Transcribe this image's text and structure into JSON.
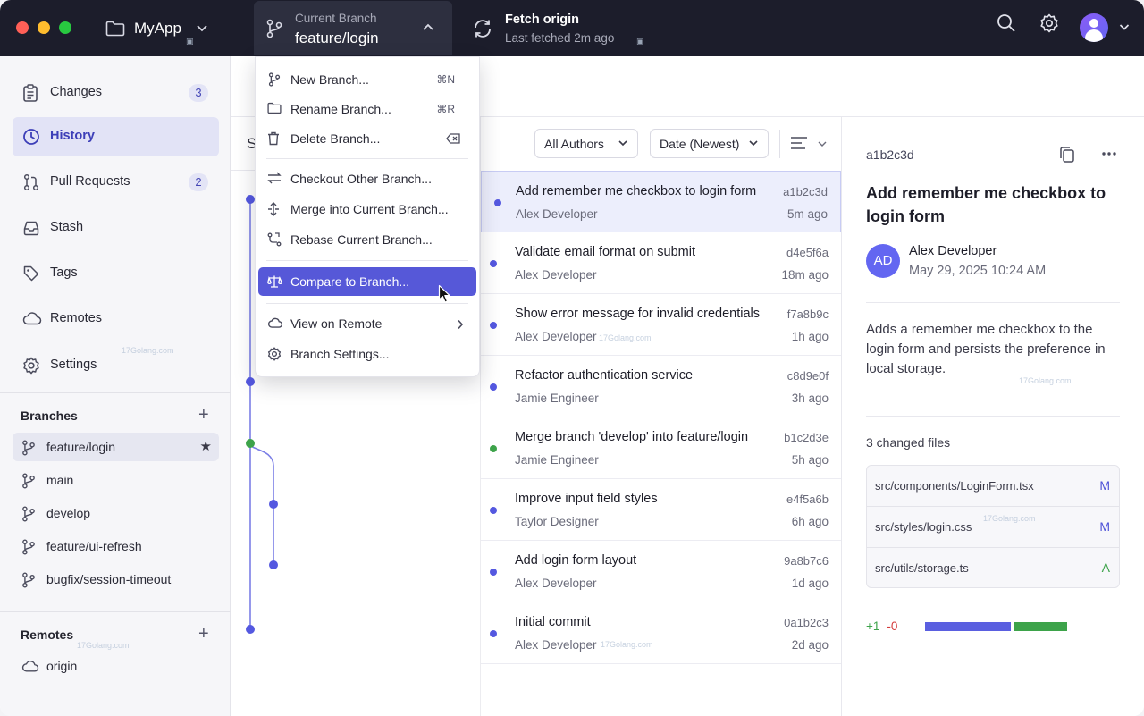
{
  "titlebar": {
    "app_name": "MyApp",
    "branch_label": "Current Branch",
    "branch_value": "feature/login",
    "fetch_title": "Fetch origin",
    "fetch_sub": "Last fetched 2m ago"
  },
  "sidebar": {
    "items": [
      {
        "label": "Changes",
        "badge": "3"
      },
      {
        "label": "History",
        "badge": ""
      },
      {
        "label": "Pull Requests",
        "badge": "2"
      },
      {
        "label": "Stash",
        "badge": ""
      },
      {
        "label": "Tags",
        "badge": ""
      },
      {
        "label": "Remotes",
        "badge": ""
      },
      {
        "label": "Settings",
        "badge": ""
      }
    ],
    "branches_title": "Branches",
    "branches": [
      "feature/login",
      "main",
      "develop",
      "feature/ui-refresh",
      "bugfix/session-timeout"
    ],
    "remotes_title": "Remotes",
    "remotes": [
      "origin"
    ],
    "add_symbol": "+"
  },
  "column_header": {
    "letter": "S"
  },
  "filters": {
    "authors": "All Authors",
    "date": "Date (Newest)"
  },
  "commits": [
    {
      "title": "Add remember me checkbox to login form",
      "author": "Alex Developer",
      "hash": "a1b2c3d",
      "time": "5m ago"
    },
    {
      "title": "Validate email format on submit",
      "author": "Alex Developer",
      "hash": "d4e5f6a",
      "time": "18m ago"
    },
    {
      "title": "Show error message for invalid credentials",
      "author": "Alex Developer",
      "hash": "f7a8b9c",
      "time": "1h ago"
    },
    {
      "title": "Refactor authentication service",
      "author": "Jamie Engineer",
      "hash": "c8d9e0f",
      "time": "3h ago"
    },
    {
      "title": "Merge branch 'develop' into feature/login",
      "author": "Jamie Engineer",
      "hash": "b1c2d3e",
      "time": "5h ago"
    },
    {
      "title": "Improve input field styles",
      "author": "Taylor Designer",
      "hash": "e4f5a6b",
      "time": "6h ago"
    },
    {
      "title": "Add login form layout",
      "author": "Alex Developer",
      "hash": "9a8b7c6",
      "time": "1d ago"
    },
    {
      "title": "Initial commit",
      "author": "Alex Developer",
      "hash": "0a1b2c3",
      "time": "2d ago"
    }
  ],
  "detail": {
    "hash": "a1b2c3d",
    "title": "Add remember me checkbox to login form",
    "avatar_initials": "AD",
    "author": "Alex Developer",
    "date": "May 29, 2025 10:24 AM",
    "description": "Adds a remember me checkbox to the login form and persists the preference in local storage.",
    "changed_files_label": "3 changed files",
    "files": [
      {
        "path": "src/components/LoginForm.tsx",
        "status": "M"
      },
      {
        "path": "src/styles/login.css",
        "status": "M"
      },
      {
        "path": "src/utils/storage.ts",
        "status": "A"
      }
    ],
    "additions": "+1",
    "deletions": "-0"
  },
  "menu": {
    "items": [
      {
        "label": "New Branch...",
        "shortcut": "⌘N"
      },
      {
        "label": "Rename Branch...",
        "shortcut": "⌘R"
      },
      {
        "label": "Delete Branch...",
        "shortcut": ""
      },
      {
        "label": "Checkout Other Branch...",
        "shortcut": ""
      },
      {
        "label": "Merge into Current Branch...",
        "shortcut": ""
      },
      {
        "label": "Rebase Current Branch...",
        "shortcut": ""
      },
      {
        "label": "Compare to Branch...",
        "shortcut": ""
      },
      {
        "label": "View on Remote",
        "shortcut": ""
      },
      {
        "label": "Branch Settings...",
        "shortcut": ""
      }
    ]
  },
  "watermark": "17Golang.com",
  "colors": {
    "accent": "#5658d8",
    "titlebar": "#1c1d2b",
    "added": "#3da34a",
    "deleted": "#d43b3b"
  }
}
